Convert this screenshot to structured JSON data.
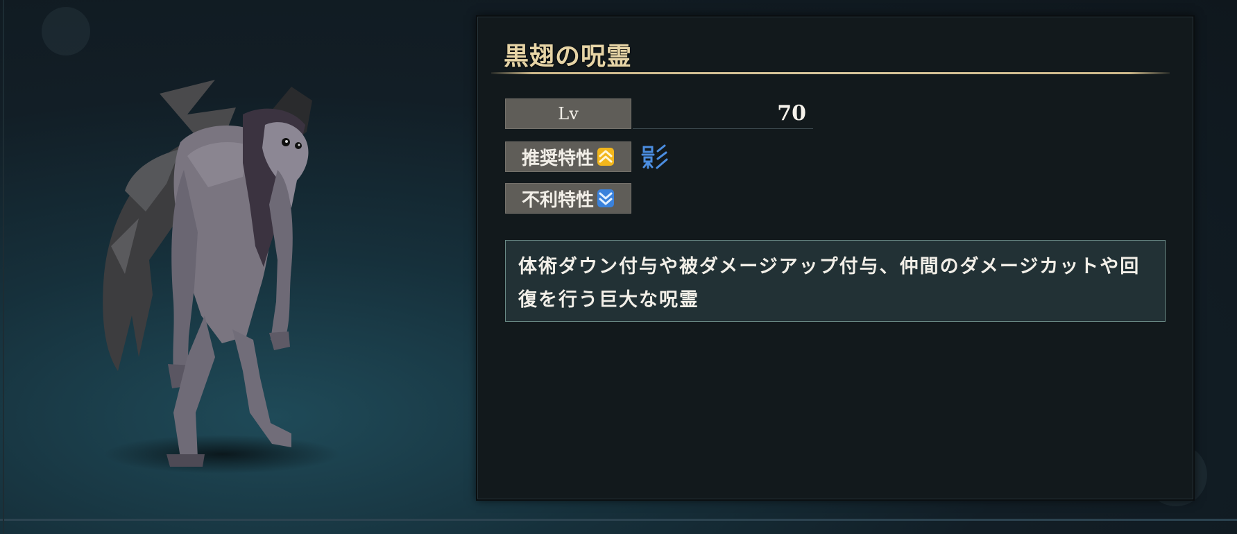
{
  "enemy": {
    "name": "黒翅の呪霊",
    "level_label": "Lv",
    "level_value": "70",
    "recommended_label": "推奨特性",
    "recommended_trait_icon": "shadow-trait-icon",
    "weak_label": "不利特性",
    "description": "体術ダウン付与や被ダメージアップ付与、仲間のダメージカットや回復を行う巨大な呪霊"
  },
  "colors": {
    "title_gold": "#e6d4a6",
    "up_arrow": "#f2b61c",
    "down_arrow": "#3a82dc",
    "trait_blue": "#4b8de0"
  }
}
